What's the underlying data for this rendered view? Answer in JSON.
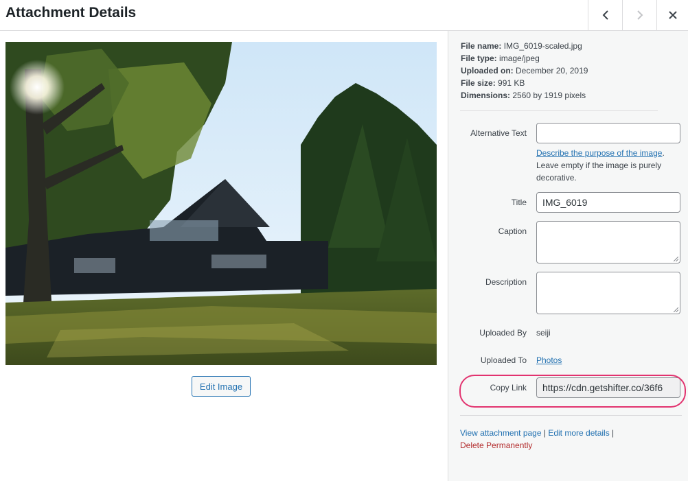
{
  "header": {
    "title": "Attachment Details",
    "prev_icon": "chevron-left-icon",
    "next_icon": "chevron-right-icon",
    "close_icon": "close-icon"
  },
  "media": {
    "edit_button_label": "Edit Image"
  },
  "file_info": {
    "file_name_label": "File name:",
    "file_name": "IMG_6019-scaled.jpg",
    "file_type_label": "File type:",
    "file_type": "image/jpeg",
    "uploaded_on_label": "Uploaded on:",
    "uploaded_on": "December 20, 2019",
    "file_size_label": "File size:",
    "file_size": "991 KB",
    "dimensions_label": "Dimensions:",
    "dimensions": "2560 by 1919 pixels"
  },
  "fields": {
    "alt_text_label": "Alternative Text",
    "alt_text_value": "",
    "alt_help_link": "Describe the purpose of the image",
    "alt_help_period": ".",
    "alt_help_text": "Leave empty if the image is purely decorative.",
    "title_label": "Title",
    "title_value": "IMG_6019",
    "caption_label": "Caption",
    "caption_value": "",
    "description_label": "Description",
    "description_value": "",
    "uploaded_by_label": "Uploaded By",
    "uploaded_by": "seiji",
    "uploaded_to_label": "Uploaded To",
    "uploaded_to": "Photos",
    "copy_link_label": "Copy Link",
    "copy_link_value": "https://cdn.getshifter.co/36f6"
  },
  "actions": {
    "view_attachment": "View attachment page",
    "sep1": " | ",
    "edit_more": "Edit more details",
    "sep2": " |",
    "delete": "Delete Permanently"
  },
  "colors": {
    "link": "#2271b1",
    "delete": "#b32d2e",
    "highlight": "#e2336f"
  }
}
